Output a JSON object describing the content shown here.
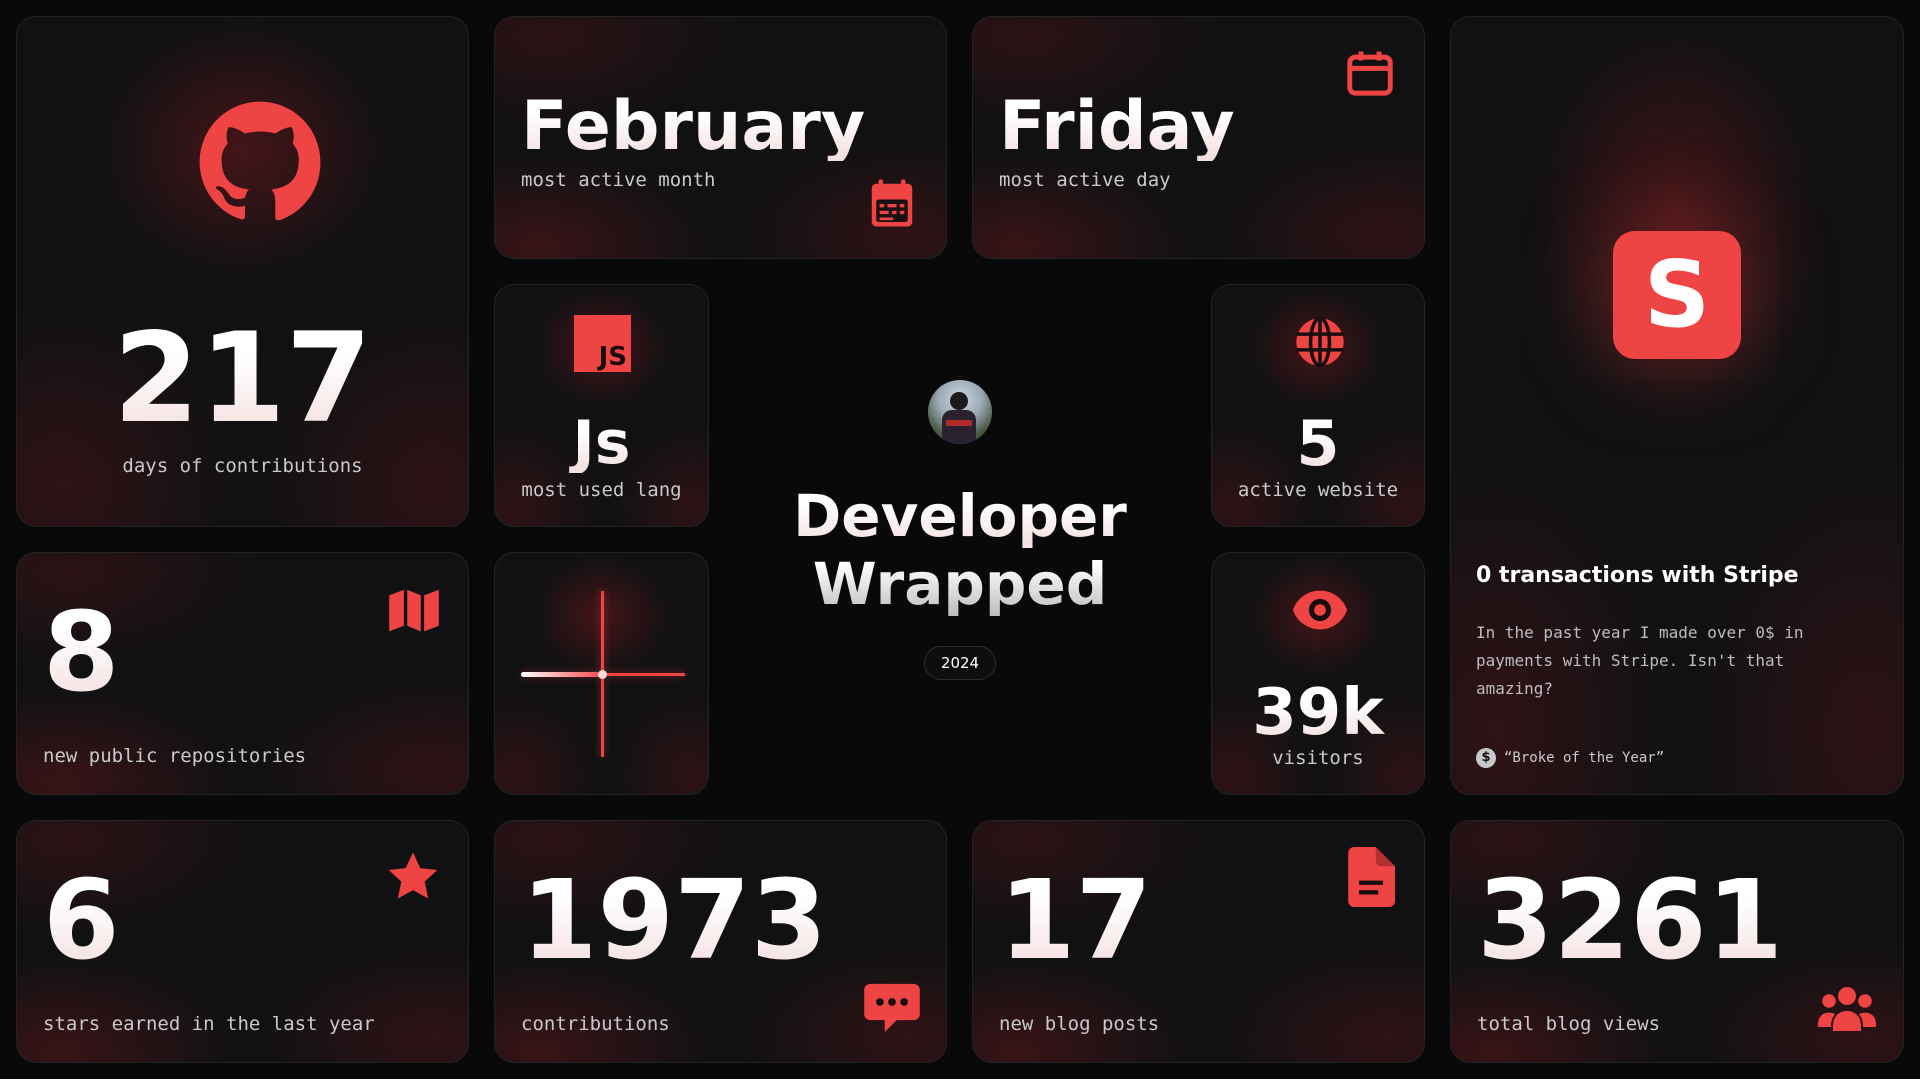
{
  "center": {
    "title_line1": "Developer",
    "title_line2": "Wrapped",
    "year": "2024"
  },
  "contributions_days": {
    "value": "217",
    "label": "days of contributions",
    "icon": "github-icon"
  },
  "active_month": {
    "value": "February",
    "label": "most active month",
    "icon": "calendar-week-icon"
  },
  "active_day": {
    "value": "Friday",
    "label": "most active day",
    "icon": "calendar-icon"
  },
  "lang": {
    "badge": "JS",
    "value": "Js",
    "label": "most used lang",
    "icon": "javascript-icon"
  },
  "websites": {
    "value": "5",
    "label": "active website",
    "icon": "globe-icon"
  },
  "repos": {
    "value": "8",
    "label": "new public repositories",
    "icon": "map-icon"
  },
  "visitors": {
    "value": "39k",
    "label": "visitors",
    "icon": "eye-icon"
  },
  "stripe": {
    "logo_letter": "S",
    "title": "0 transactions with Stripe",
    "description": "In the past year I made over 0$ in payments with Stripe. Isn't that amazing?",
    "award": "“Broke of the Year”",
    "icon": "stripe-icon"
  },
  "stars": {
    "value": "6",
    "label": "stars earned in the last year",
    "icon": "star-icon"
  },
  "contributions": {
    "value": "1973",
    "label": "contributions",
    "icon": "chat-bubble-icon"
  },
  "blog_posts": {
    "value": "17",
    "label": "new blog posts",
    "icon": "file-icon"
  },
  "blog_views": {
    "value": "3261",
    "label": "total blog views",
    "icon": "users-icon"
  },
  "colors": {
    "accent": "#ef4444",
    "background": "#09090b",
    "card": "#111113"
  }
}
